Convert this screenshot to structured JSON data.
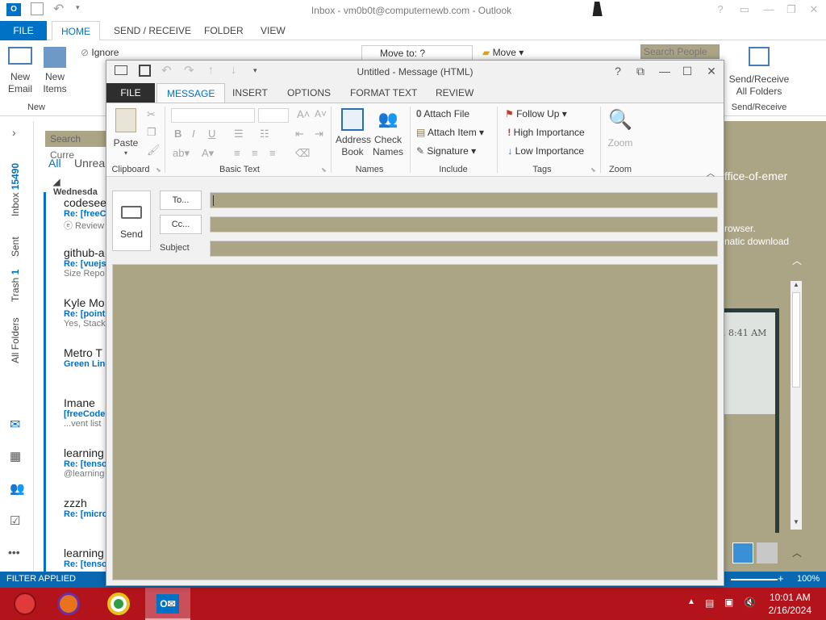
{
  "outlook": {
    "title": "Inbox - vm0b0t@computernewb.com - Outlook",
    "tabs": [
      "FILE",
      "HOME",
      "SEND / RECEIVE",
      "FOLDER",
      "VIEW"
    ],
    "ribbon": {
      "new_email": "New Email",
      "new_items": "New Items",
      "new_group": "New",
      "ignore": "Ignore",
      "move_to": "Move to: ?",
      "move": "Move",
      "search_people": "Search People",
      "send_receive_all": "Send/Receive All Folders",
      "send_receive_group": "Send/Receive"
    },
    "search_placeholder": "Search Curre",
    "filters": {
      "all": "All",
      "unread": "Unrea"
    },
    "date_group": "Wednesda",
    "nav_folders": [
      {
        "label": "Inbox",
        "count": "15490"
      },
      {
        "label": "Sent"
      },
      {
        "label": "Trash",
        "count": "1"
      },
      {
        "label": "All Folders"
      }
    ],
    "mail_items": [
      {
        "from": "codesee",
        "subject": "Re: [freeC",
        "preview": "ⓔ Review"
      },
      {
        "from": "github-a",
        "subject": "Re: [vuejs",
        "preview": "Size Repo"
      },
      {
        "from": "Kyle Mo",
        "subject": "Re: [point",
        "preview": "Yes, Stack"
      },
      {
        "from": "Metro T",
        "subject": "Green Lin",
        "preview": ""
      },
      {
        "from": "Imane",
        "subject": "[freeCode",
        "preview": "...vent list"
      },
      {
        "from": "learning",
        "subject": "Re: [tenso",
        "preview": "@learning"
      },
      {
        "from": "zzzh",
        "subject": "Re: [micro",
        "preview": ""
      },
      {
        "from": "learning",
        "subject": "Re: [tenso",
        "preview": ""
      }
    ],
    "reading_pane": {
      "text1": "ffice-of-emer",
      "text2": "rowser.",
      "text3": "natic download",
      "timestamp": ", 8:41 AM"
    },
    "status": {
      "filter": "FILTER APPLIED",
      "zoom": "100%"
    }
  },
  "compose": {
    "title": "Untitled - Message (HTML)",
    "tabs": [
      "FILE",
      "MESSAGE",
      "INSERT",
      "OPTIONS",
      "FORMAT TEXT",
      "REVIEW"
    ],
    "ribbon": {
      "paste": "Paste",
      "clipboard": "Clipboard",
      "basic_text": "Basic Text",
      "address_book": "Address Book",
      "check_names": "Check Names",
      "names": "Names",
      "attach_file": "Attach File",
      "attach_item": "Attach Item",
      "signature": "Signature",
      "include": "Include",
      "follow_up": "Follow Up",
      "high_importance": "High Importance",
      "low_importance": "Low Importance",
      "tags": "Tags",
      "zoom": "Zoom",
      "zoom_group": "Zoom"
    },
    "send": "Send",
    "to_button": "To...",
    "cc_button": "Cc...",
    "subject_label": "Subject",
    "to_value": "",
    "cc_value": "",
    "subject_value": ""
  },
  "taskbar": {
    "time": "10:01 AM",
    "date": "2/16/2024"
  },
  "colors": {
    "accent": "#0072c6",
    "taskbar": "#b3131b",
    "compose_file_tab": "#2e2e2e",
    "field_fill": "#aba586"
  }
}
